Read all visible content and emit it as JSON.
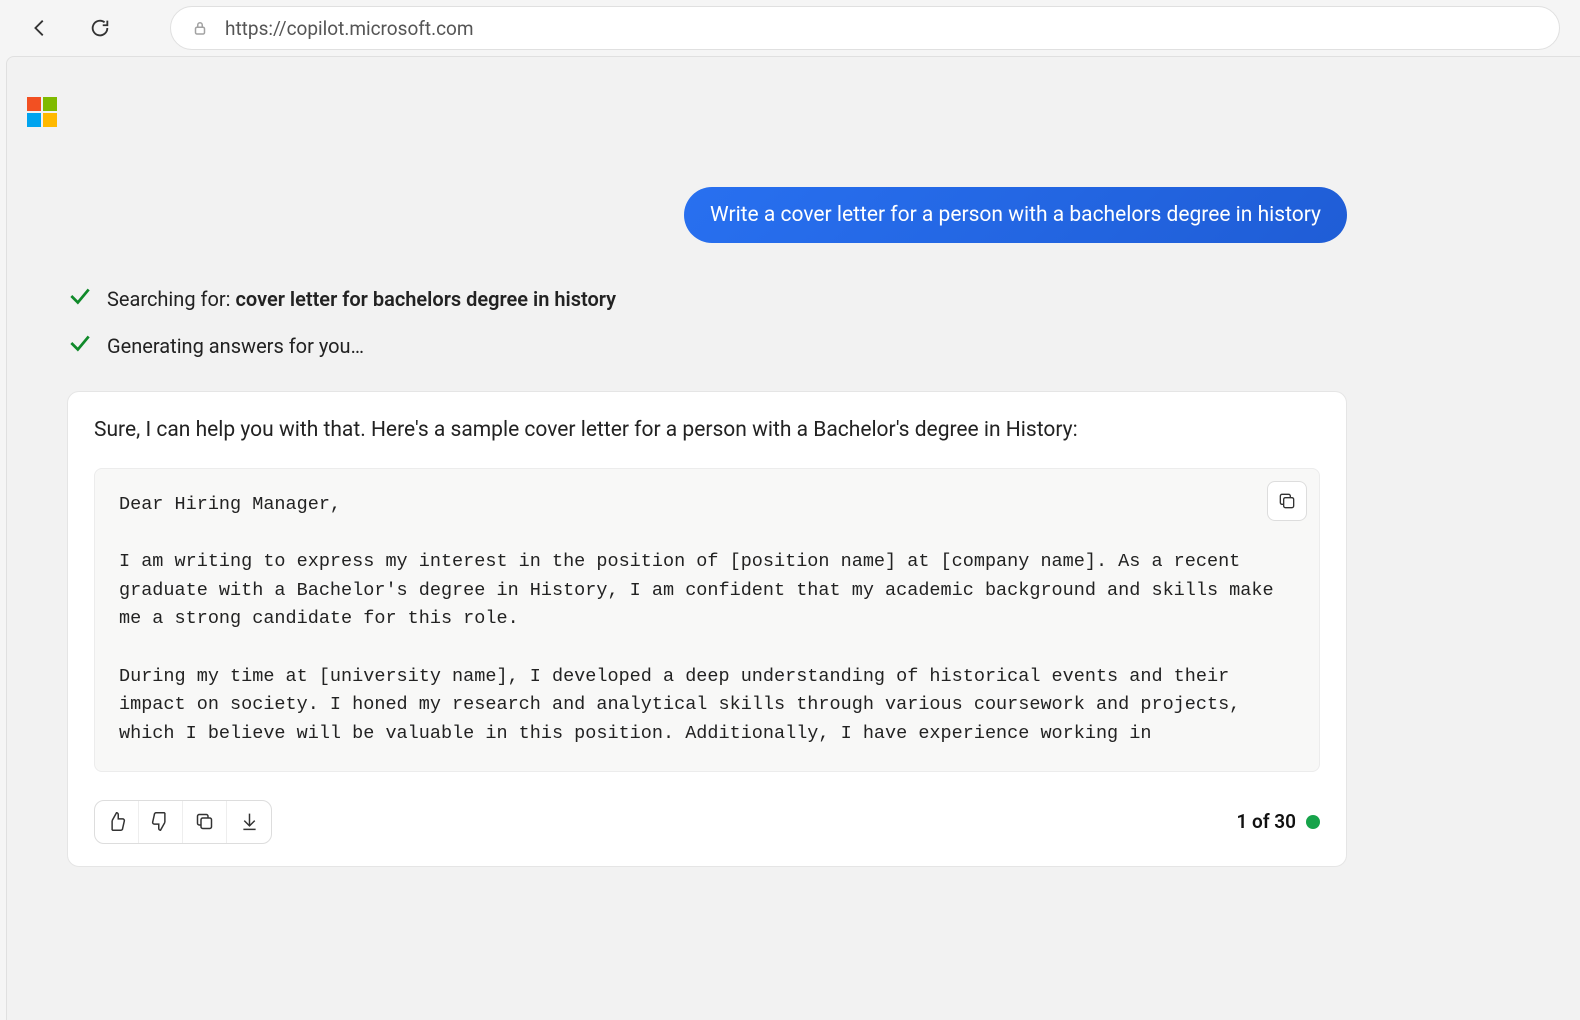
{
  "browser": {
    "url": "https://copilot.microsoft.com"
  },
  "chat": {
    "user_message": "Write a cover letter for a person with a bachelors degree in history",
    "status": {
      "searching_prefix": "Searching for: ",
      "searching_query": "cover letter for bachelors degree in history",
      "generating": "Generating answers for you…"
    },
    "response": {
      "intro": "Sure, I can help you with that. Here's a sample cover letter for a person with a Bachelor's degree in History:",
      "letter": "Dear Hiring Manager,\n\nI am writing to express my interest in the position of [position name] at [company name]. As a recent graduate with a Bachelor's degree in History, I am confident that my academic background and skills make me a strong candidate for this role.\n\nDuring my time at [university name], I developed a deep understanding of historical events and their impact on society. I honed my research and analytical skills through various coursework and projects, which I believe will be valuable in this position. Additionally, I have experience working in"
    },
    "pager": "1 of 30"
  }
}
